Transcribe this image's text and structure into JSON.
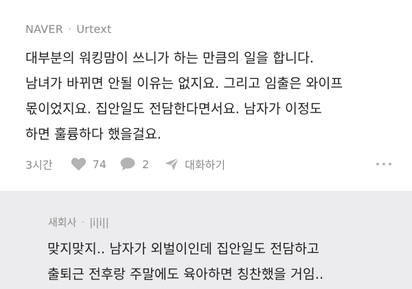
{
  "comment": {
    "source": "NAVER",
    "author": "Urtext",
    "lines": [
      "대부분의 워킹맘이 쓰니가 하는 만큼의 일을 합니다.",
      "남녀가 바뀌면 안될 이유는 없지요. 그리고 임출은 와이프",
      "몫이었지요. 집안일도 전담한다면서요. 남자가 이정도",
      "하면 훌륭하다 했을걸요."
    ],
    "time": "3시간",
    "likes": "74",
    "replies": "2",
    "share_label": "대화하기",
    "colors": {
      "icon": "#b3b3b3",
      "meta_text": "#8a8a8a"
    },
    "icons": [
      "heart-icon",
      "speech-bubble-icon",
      "paper-plane-icon",
      "more-icon"
    ]
  },
  "reply": {
    "source": "새회사",
    "author": "|i|i||",
    "lines": [
      "맞지맞지.. 남자가 외벌이인데 집안일도 전담하고",
      "출퇴근 전후랑 주말에도 육아하면 칭찬했을 거임.."
    ],
    "background": "#ececee"
  }
}
